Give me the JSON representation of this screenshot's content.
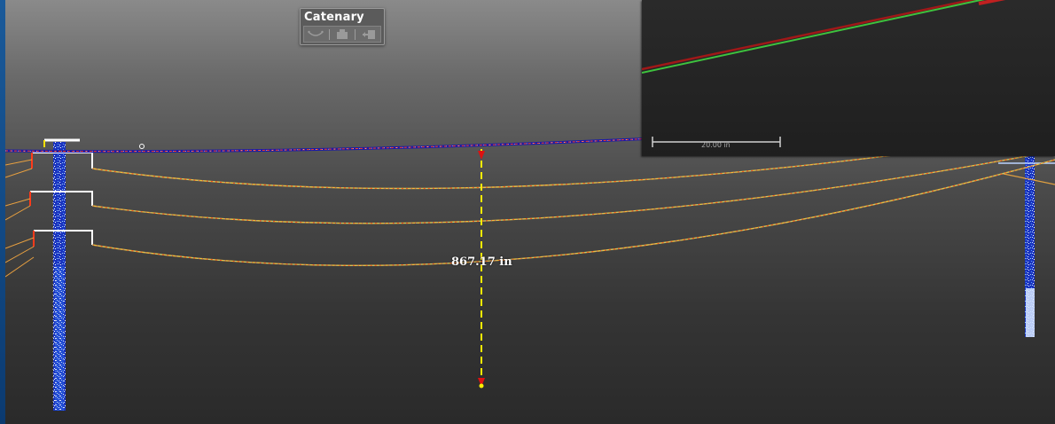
{
  "catenary_panel": {
    "title": "Catenary",
    "tools": [
      {
        "icon": "catenary-curve-icon"
      },
      {
        "icon": "point-cloud-icon"
      },
      {
        "icon": "exit-icon"
      }
    ]
  },
  "measurement": {
    "label": "867.17 in"
  },
  "inset_view": {
    "scale_label": "20.00 in"
  },
  "colors": {
    "conductor_fit": "#1a1aa8",
    "measure_line": "#ffee00",
    "measure_arrow": "#dd1111",
    "pole": "#1e3ec8",
    "inset_fit_red": "#a01818",
    "inset_fit_green": "#3ec23e"
  }
}
